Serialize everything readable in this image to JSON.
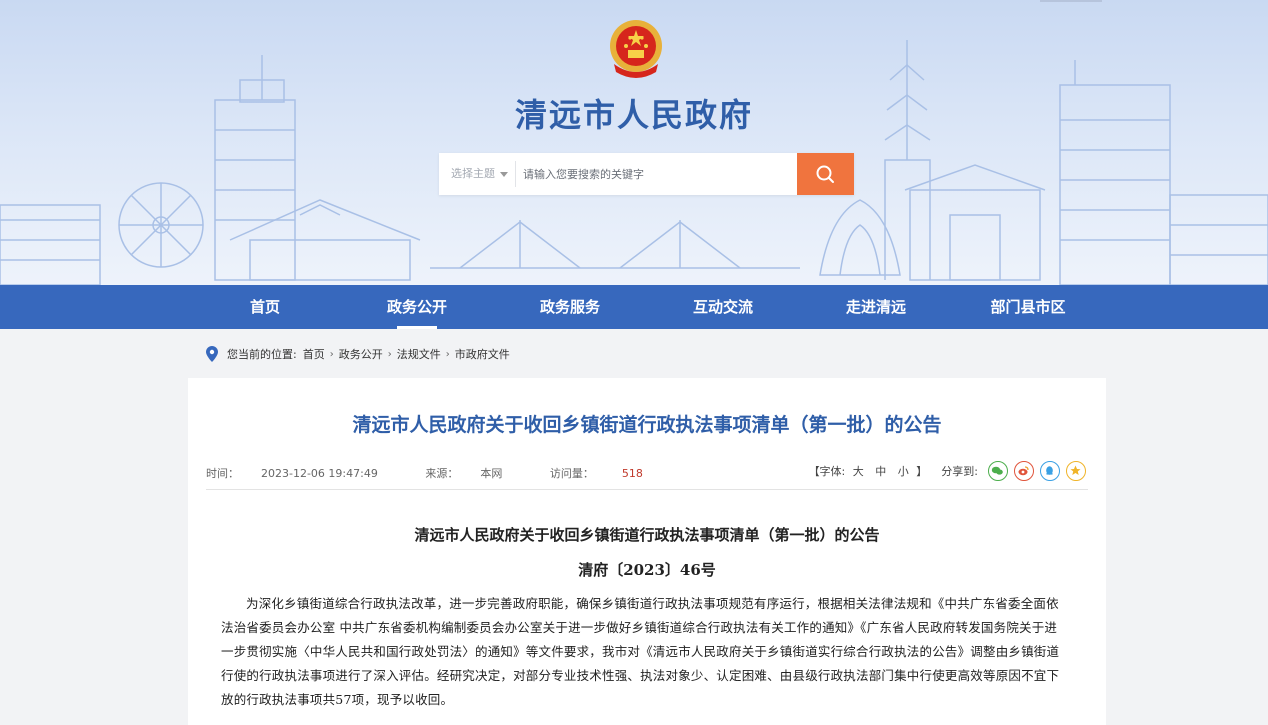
{
  "header": {
    "site_title": "清远市人民政府",
    "search": {
      "topic_select": "选择主题",
      "placeholder": "请输入您要搜索的关键字"
    }
  },
  "nav": {
    "items": [
      {
        "label": "首页"
      },
      {
        "label": "政务公开"
      },
      {
        "label": "政务服务"
      },
      {
        "label": "互动交流"
      },
      {
        "label": "走进清远"
      },
      {
        "label": "部门县市区"
      }
    ],
    "active": "政务公开"
  },
  "breadcrumb": {
    "prefix": "您当前的位置:",
    "items": [
      "首页",
      "政务公开",
      "法规文件",
      "市政府文件"
    ],
    "separator": "›"
  },
  "article": {
    "title": "清远市人民政府关于收回乡镇街道行政执法事项清单（第一批）的公告",
    "time_label": "时间：",
    "time": "2023-12-06 19:47:49",
    "source_label": "来源：",
    "source": "本网",
    "views_label": "访问量：",
    "views": "518",
    "font_size_label": "【字体:",
    "font_sizes": [
      "大",
      "中",
      "小"
    ],
    "font_size_close": "】",
    "share_label": "分享到:",
    "share_icons": [
      "wechat-icon",
      "weibo-icon",
      "qq-icon",
      "favorite-icon"
    ],
    "doc_title": "清远市人民政府关于收回乡镇街道行政执法事项清单（第一批）的公告",
    "doc_number": "清府〔2023〕46号",
    "body": "为深化乡镇街道综合行政执法改革，进一步完善政府职能，确保乡镇街道行政执法事项规范有序运行，根据相关法律法规和《中共广东省委全面依法治省委员会办公室 中共广东省委机构编制委员会办公室关于进一步做好乡镇街道综合行政执法有关工作的通知》《广东省人民政府转发国务院关于进一步贯彻实施〈中华人民共和国行政处罚法〉的通知》等文件要求，我市对《清远市人民政府关于乡镇街道实行综合行政执法的公告》调整由乡镇街道行使的行政执法事项进行了深入评估。经研究决定，对部分专业技术性强、执法对象少、认定困难、由县级行政执法部门集中行使更高效等原因不宜下放的行政执法事项共57项，现予以收回。"
  },
  "colors": {
    "brand_blue": "#3768bd",
    "title_blue": "#2f5ea8",
    "search_button": "#f0743e",
    "views_red": "#c0392b"
  }
}
